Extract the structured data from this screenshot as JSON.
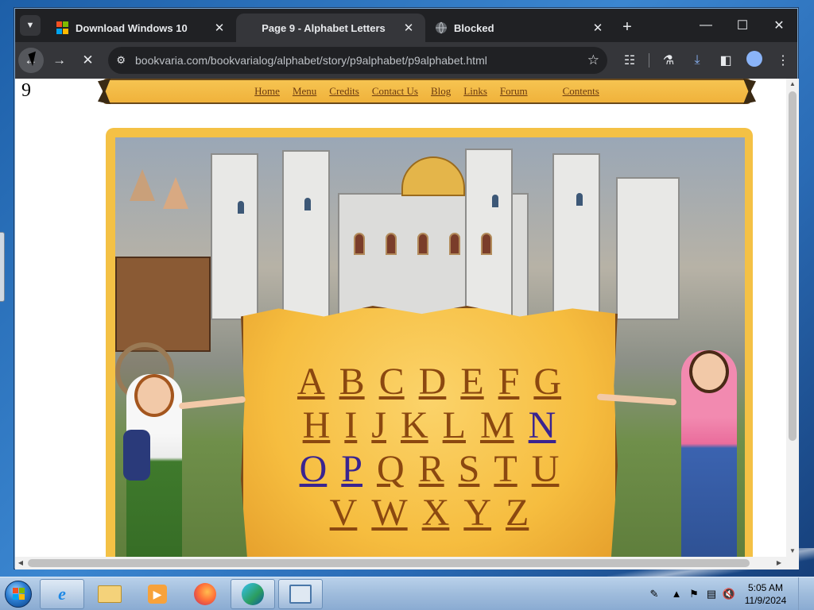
{
  "browser": {
    "tabs": [
      {
        "title": "Download Windows 10",
        "icon": "windows-logo-icon",
        "active": false
      },
      {
        "title": "Page 9 - Alphabet Letters",
        "icon": "none",
        "active": true
      },
      {
        "title": "Blocked",
        "icon": "globe-icon",
        "active": false
      }
    ],
    "address": "bookvaria.com/bookvarialog/alphabet/story/p9alphabet/p9alphabet.html"
  },
  "page": {
    "page_number": "9",
    "nav": [
      "Home",
      "Menu",
      "Credits",
      "Contact Us",
      "Blog",
      "Links",
      "Forum",
      "Contents"
    ],
    "letter_rows": [
      [
        "A",
        "B",
        "C",
        "D",
        "E",
        "F",
        "G"
      ],
      [
        "H",
        "I",
        "J",
        "K",
        "L",
        "M",
        "N"
      ],
      [
        "O",
        "P",
        "Q",
        "R",
        "S",
        "T",
        "U"
      ],
      [
        "V",
        "W",
        "X",
        "Y",
        "Z"
      ]
    ],
    "visited_letters": [
      "N",
      "O",
      "P"
    ]
  },
  "taskbar": {
    "apps": [
      "internet-explorer-icon",
      "file-explorer-icon",
      "media-player-icon",
      "firefox-icon",
      "edge-icon",
      "remote-desktop-icon"
    ],
    "time": "5:05 AM",
    "date": "11/9/2024"
  },
  "colors": {
    "link": "#8b4810",
    "visited_link": "#3a2490",
    "frame": "#f4c145",
    "chrome_dark": "#202124"
  }
}
